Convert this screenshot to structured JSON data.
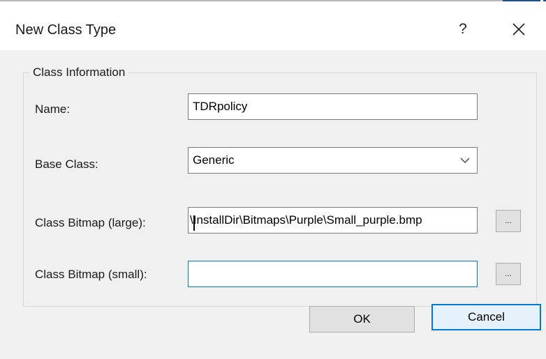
{
  "dialog": {
    "title": "New Class Type",
    "help_label": "?",
    "close_icon": "close-icon"
  },
  "class_information": {
    "legend": "Class Information",
    "name": {
      "label": "Name:",
      "value": "TDRpolicy"
    },
    "base_class": {
      "label": "Base Class:",
      "value": "Generic"
    },
    "bitmap_large": {
      "label": "Class Bitmap (large):",
      "value": "\\InstallDir\\Bitmaps\\Purple\\Small_purple.bmp",
      "browse_label": "..."
    },
    "bitmap_small": {
      "label": "Class Bitmap (small):",
      "value": "",
      "browse_label": "..."
    }
  },
  "buttons": {
    "ok": "OK",
    "cancel": "Cancel"
  },
  "colors": {
    "accent": "#0078d7",
    "dialog_bg": "#f0f0f0"
  }
}
